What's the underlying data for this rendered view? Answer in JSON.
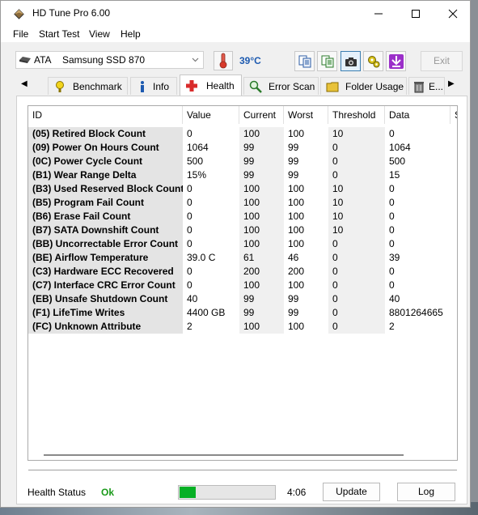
{
  "app": {
    "title": "HD Tune Pro 6.00"
  },
  "menu": [
    "File",
    "Start Test",
    "View",
    "Help"
  ],
  "drive": {
    "type": "ATA",
    "name": "Samsung SSD 870"
  },
  "temperature": "39°C",
  "toolbar": {
    "exit_label": "Exit"
  },
  "tabs": [
    {
      "label": "Benchmark",
      "icon": "benchmark-icon"
    },
    {
      "label": "Info",
      "icon": "info-icon"
    },
    {
      "label": "Health",
      "icon": "health-icon",
      "active": true
    },
    {
      "label": "Error Scan",
      "icon": "magnifier-icon"
    },
    {
      "label": "Folder Usage",
      "icon": "folder-icon"
    },
    {
      "label": "E...",
      "icon": "trash-icon"
    }
  ],
  "table": {
    "columns": [
      "ID",
      "Value",
      "Current",
      "Worst",
      "Threshold",
      "Data",
      "S"
    ],
    "rows": [
      [
        "(05) Retired Block Count",
        "0",
        "100",
        "100",
        "10",
        "0"
      ],
      [
        "(09) Power On Hours Count",
        "1064",
        "99",
        "99",
        "0",
        "1064"
      ],
      [
        "(0C) Power Cycle Count",
        "500",
        "99",
        "99",
        "0",
        "500"
      ],
      [
        "(B1) Wear Range Delta",
        "15%",
        "99",
        "99",
        "0",
        "15"
      ],
      [
        "(B3) Used Reserved Block Count",
        "0",
        "100",
        "100",
        "10",
        "0"
      ],
      [
        "(B5) Program Fail Count",
        "0",
        "100",
        "100",
        "10",
        "0"
      ],
      [
        "(B6) Erase Fail Count",
        "0",
        "100",
        "100",
        "10",
        "0"
      ],
      [
        "(B7) SATA Downshift Count",
        "0",
        "100",
        "100",
        "10",
        "0"
      ],
      [
        "(BB) Uncorrectable Error Count",
        "0",
        "100",
        "100",
        "0",
        "0"
      ],
      [
        "(BE) Airflow Temperature",
        "39.0 C",
        "61",
        "46",
        "0",
        "39"
      ],
      [
        "(C3) Hardware ECC Recovered",
        "0",
        "200",
        "200",
        "0",
        "0"
      ],
      [
        "(C7) Interface CRC Error Count",
        "0",
        "100",
        "100",
        "0",
        "0"
      ],
      [
        "(EB) Unsafe Shutdown Count",
        "40",
        "99",
        "99",
        "0",
        "40"
      ],
      [
        "(F1) LifeTime Writes",
        "4400 GB",
        "99",
        "99",
        "0",
        "8801264665"
      ],
      [
        "(FC) Unknown Attribute",
        "2",
        "100",
        "100",
        "0",
        "2"
      ]
    ]
  },
  "status": {
    "label": "Health Status",
    "value": "Ok",
    "progress": 0.17,
    "time": "4:06",
    "update_label": "Update",
    "log_label": "Log"
  },
  "colors": {
    "status_ok": "#1a9a1a",
    "progress": "#06b025",
    "temperature": "#1d5ab0"
  }
}
